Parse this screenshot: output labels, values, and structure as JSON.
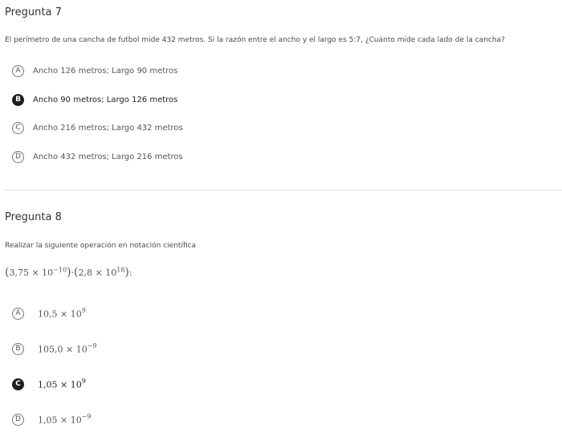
{
  "q7": {
    "title": "Pregunta 7",
    "text": "El perímetro de una cancha de futbol mide 432 metros. Si la razón entre el ancho y el largo es 5:7, ¿Cuánto mide cada lado de la cancha?",
    "options": [
      {
        "letter": "A",
        "label": "Ancho 126 metros; Largo 90 metros",
        "selected": false
      },
      {
        "letter": "B",
        "label": "Ancho 90 metros; Largo 126 metros",
        "selected": true
      },
      {
        "letter": "C",
        "label": "Ancho 216 metros; Largo 432 metros",
        "selected": false
      },
      {
        "letter": "D",
        "label": "Ancho 432 metros; Largo 216 metros",
        "selected": false
      }
    ]
  },
  "q8": {
    "title": "Pregunta 8",
    "text": "Realizar la siguiente operación en notación científica",
    "expression": {
      "open1": "(",
      "a_mantissa": "3,75",
      "times1": " × 10",
      "a_exp": "−10",
      "close1": ")",
      "dot": "·",
      "open2": "(",
      "b_mantissa": "2,8",
      "times2": " × 10",
      "b_exp": "18",
      "close2": ")",
      "colon": ":"
    },
    "options": [
      {
        "letter": "A",
        "mantissa": "10,5",
        "times": " × 10",
        "exp": "9",
        "selected": false
      },
      {
        "letter": "B",
        "mantissa": "105,0",
        "times": " × 10",
        "exp": "−9",
        "selected": false
      },
      {
        "letter": "C",
        "mantissa": "1,05",
        "times": " × 10",
        "exp": "9",
        "selected": true
      },
      {
        "letter": "D",
        "mantissa": "1,05",
        "times": " × 10",
        "exp": "−9",
        "selected": false
      }
    ]
  }
}
